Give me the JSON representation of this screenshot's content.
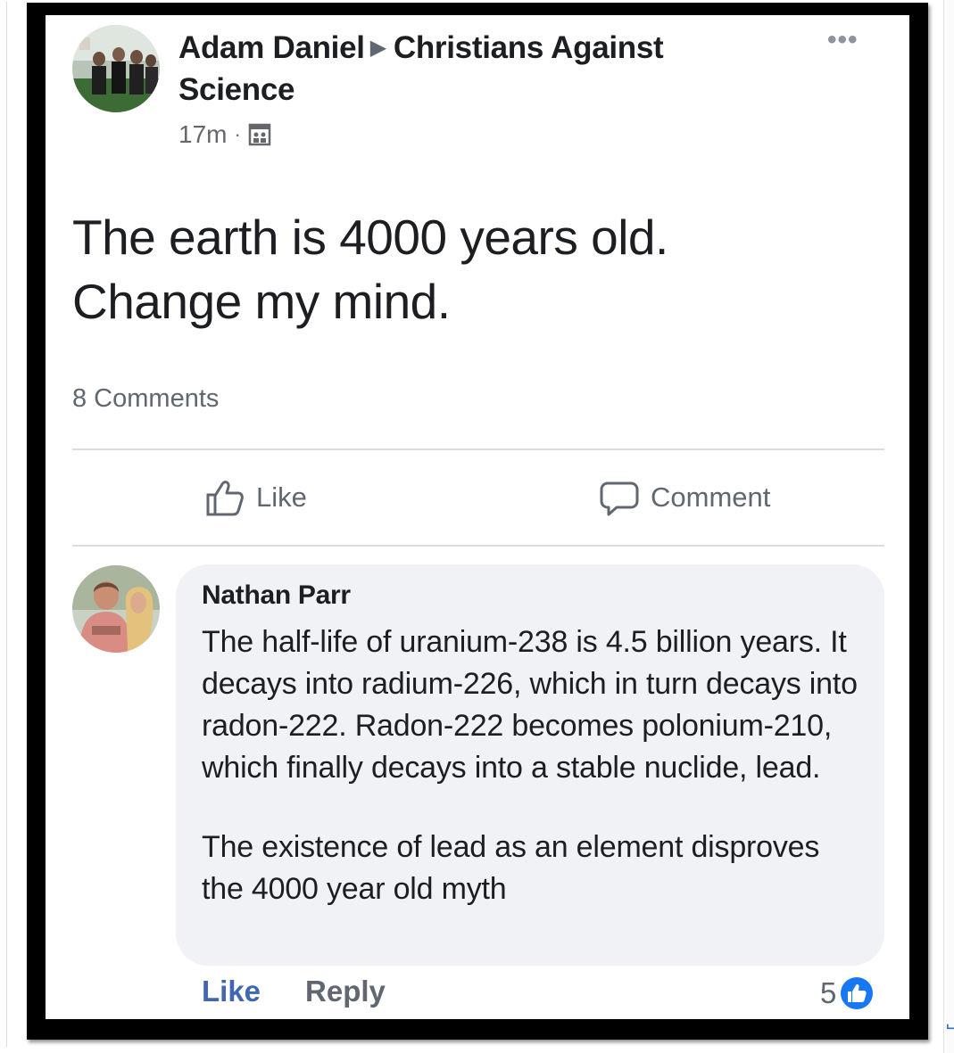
{
  "post": {
    "author": "Adam Daniel",
    "group": "Christians Against Science",
    "time": "17m",
    "privacy_icon": "group-icon",
    "text_line1": "The earth is 4000 years old.",
    "text_line2": "Change my mind.",
    "comments_count": "8 Comments",
    "more_icon": "ellipsis-icon"
  },
  "actions": {
    "like_label": "Like",
    "comment_label": "Comment"
  },
  "comment": {
    "author": "Nathan Parr",
    "paragraph1": "The half-life of uranium-238 is 4.5 billion years. It decays into radium-226, which in turn decays into radon-222. Radon-222 becomes polonium-210, which finally decays into a stable nuclide, lead.",
    "paragraph2": "The existence of lead as an element disproves the 4000 year old myth",
    "like_label": "Like",
    "reply_label": "Reply",
    "reaction_count": "5"
  },
  "colors": {
    "link_blue": "#4267b2",
    "text_primary": "#1c1e21",
    "text_secondary": "#606770",
    "bubble_bg": "#f0f2f5",
    "frame": "#000000"
  }
}
